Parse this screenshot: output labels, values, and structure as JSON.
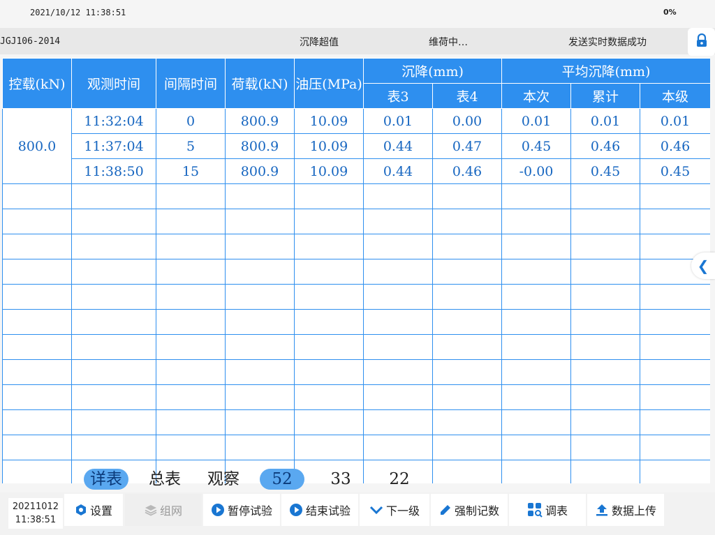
{
  "status": {
    "time": "2021/10/12 11:38:51",
    "battery": "0%"
  },
  "info": {
    "standard": "JGJ106-2014",
    "field1": "沉降超值",
    "field2": "维荷中…",
    "field3": "发送实时数据成功"
  },
  "table": {
    "headers": {
      "control_load": "控载(kN)",
      "obs_time": "观测时间",
      "interval": "间隔时间",
      "load": "荷载(kN)",
      "pressure": "油压(MPa)",
      "settlement": "沉降(mm)",
      "gauge3": "表3",
      "gauge4": "表4",
      "avg_settlement": "平均沉降(mm)",
      "this_time": "本次",
      "cumulative": "累计",
      "this_level": "本级"
    },
    "control_load_value": "800.0",
    "rows": [
      [
        "11:32:04",
        "0",
        "800.9",
        "10.09",
        "0.01",
        "0.00",
        "0.01",
        "0.01",
        "0.01"
      ],
      [
        "11:37:04",
        "5",
        "800.9",
        "10.09",
        "0.44",
        "0.47",
        "0.45",
        "0.46",
        "0.46"
      ],
      [
        "11:38:50",
        "15",
        "800.9",
        "10.09",
        "0.44",
        "0.46",
        "-0.00",
        "0.45",
        "0.45"
      ]
    ]
  },
  "tabs": [
    "详表",
    "总表",
    "观察",
    "52",
    "33",
    "22"
  ],
  "footer": {
    "date": "20211012",
    "time": "11:38:51",
    "buttons": [
      "设置",
      "组网",
      "暂停试验",
      "结束试验",
      "下一级",
      "强制记数",
      "调表",
      "数据上传"
    ]
  },
  "icons": {
    "lock": "lock-icon",
    "side": "chevron-left-icon"
  },
  "colors": {
    "header_bg": "#2e8fef",
    "cell_text": "#1565c0",
    "grid": "#2e8fef"
  }
}
